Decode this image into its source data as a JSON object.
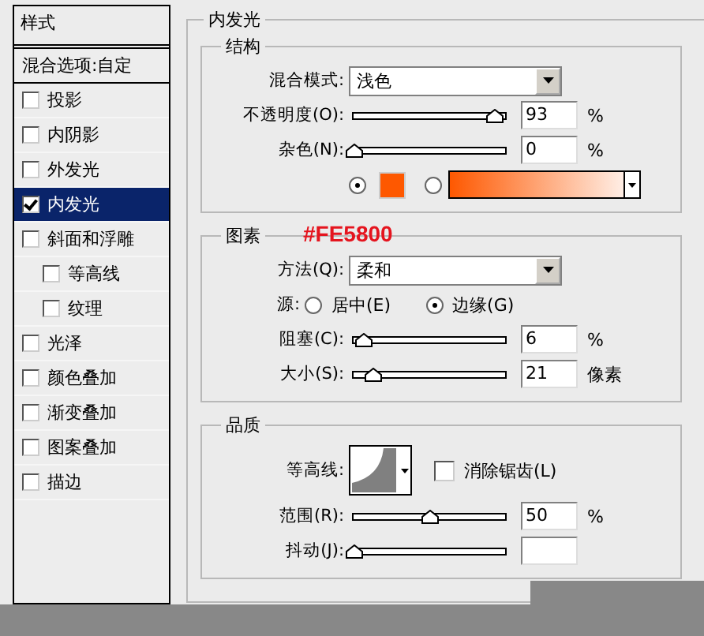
{
  "sidebar": {
    "title": "样式",
    "items": [
      {
        "label": "混合选项:自定",
        "kind": "header",
        "selected": false
      },
      {
        "label": "投影",
        "kind": "check",
        "checked": false,
        "selected": false
      },
      {
        "label": "内阴影",
        "kind": "check",
        "checked": false,
        "selected": false
      },
      {
        "label": "外发光",
        "kind": "check",
        "checked": false,
        "selected": false
      },
      {
        "label": "内发光",
        "kind": "check",
        "checked": true,
        "selected": true
      },
      {
        "label": "斜面和浮雕",
        "kind": "check",
        "checked": false,
        "selected": false,
        "children": [
          {
            "label": "等高线",
            "kind": "check",
            "checked": false,
            "selected": false
          },
          {
            "label": "纹理",
            "kind": "check",
            "checked": false,
            "selected": false
          }
        ]
      },
      {
        "label": "光泽",
        "kind": "check",
        "checked": false,
        "selected": false
      },
      {
        "label": "颜色叠加",
        "kind": "check",
        "checked": false,
        "selected": false
      },
      {
        "label": "渐变叠加",
        "kind": "check",
        "checked": false,
        "selected": false
      },
      {
        "label": "图案叠加",
        "kind": "check",
        "checked": false,
        "selected": false
      },
      {
        "label": "描边",
        "kind": "check",
        "checked": false,
        "selected": false
      }
    ]
  },
  "panel": {
    "title": "内发光",
    "groups": [
      {
        "title": "结构",
        "rows": [
          {
            "kind": "select",
            "label": "混合模式:",
            "value": "浅色"
          },
          {
            "kind": "slider",
            "label": "不透明度(O):",
            "level": 0.93,
            "value": "93",
            "unit": "%"
          },
          {
            "kind": "slider",
            "label": "杂色(N):",
            "level": 0,
            "value": "0",
            "unit": "%"
          },
          {
            "kind": "fill",
            "options": [
              {
                "kind": "color",
                "selected": true,
                "color": "#fe5800"
              },
              {
                "kind": "gradient",
                "selected": false
              }
            ]
          }
        ]
      },
      {
        "title": "图素",
        "annotation": "#FE5800",
        "rows": [
          {
            "kind": "select",
            "label": "方法(Q):",
            "value": "柔和"
          },
          {
            "kind": "radio",
            "label": "源:",
            "options": [
              {
                "label": "居中(E)",
                "selected": false
              },
              {
                "label": "边缘(G)",
                "selected": true
              }
            ]
          },
          {
            "kind": "slider",
            "label": "阻塞(C):",
            "level": 0.06,
            "value": "6",
            "unit": "%"
          },
          {
            "kind": "slider",
            "label": "大小(S):",
            "level": 0.13,
            "value": "21",
            "unit": "像素"
          }
        ]
      },
      {
        "title": "品质",
        "rows": [
          {
            "kind": "contour",
            "label": "等高线:",
            "checkbox": {
              "label": "消除锯齿(L)",
              "checked": false
            }
          },
          {
            "kind": "slider",
            "label": "范围(R):",
            "level": 0.5,
            "value": "50",
            "unit": "%"
          },
          {
            "kind": "slider",
            "label": "抖动(J):",
            "level": 0
          }
        ]
      }
    ]
  }
}
